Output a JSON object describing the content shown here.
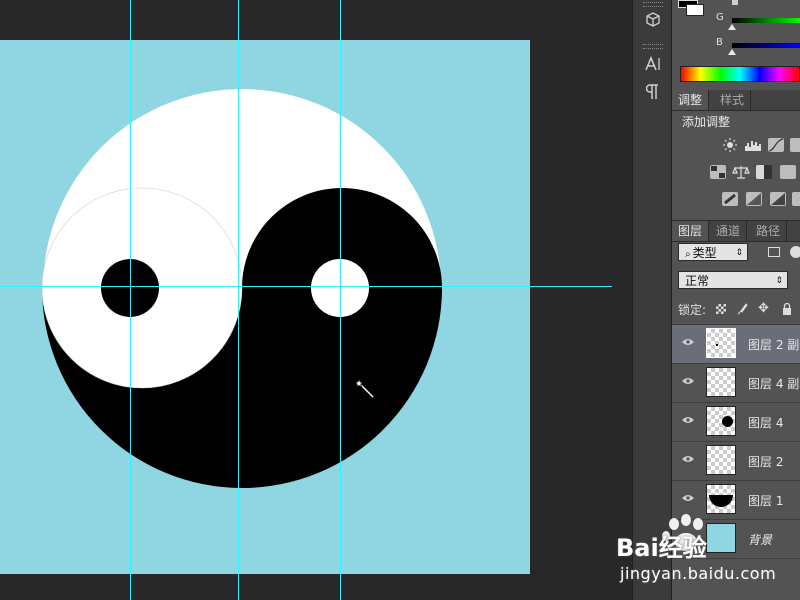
{
  "app": "Photoshop",
  "colors": {
    "canvas_bg": "#8fd5e2",
    "guide": "#2ff0ff",
    "panel_bg": "#535353",
    "selected_layer": "#6a6e78"
  },
  "color_panel": {
    "g_label": "G",
    "b_label": "B"
  },
  "adjustments": {
    "tabs": [
      {
        "label": "调整",
        "active": true
      },
      {
        "label": "样式",
        "active": false
      }
    ],
    "title": "添加调整",
    "icons": [
      "brightness-icon",
      "levels-icon",
      "curves-icon",
      "exposure-icon",
      "vibrance-icon",
      "hue-sat-icon",
      "color-balance-icon",
      "bw-icon",
      "photo-filter-icon",
      "invert-icon",
      "posterize-icon",
      "gradient-map-icon"
    ]
  },
  "layers_panel": {
    "tabs": [
      {
        "label": "图层",
        "active": true
      },
      {
        "label": "通道",
        "active": false
      },
      {
        "label": "路径",
        "active": false
      }
    ],
    "filter_label": "类型",
    "blend_mode": "正常",
    "lock_label": "锁定:",
    "layers": [
      {
        "name": "图层 2 副本",
        "selected": true,
        "thumb": "dot"
      },
      {
        "name": "图层 4 副本",
        "selected": false,
        "thumb": "empty"
      },
      {
        "name": "图层 4",
        "selected": false,
        "thumb": "black-dot"
      },
      {
        "name": "图层 2",
        "selected": false,
        "thumb": "empty"
      },
      {
        "name": "图层 1",
        "selected": false,
        "thumb": "half-circle"
      },
      {
        "name": "背景",
        "selected": false,
        "thumb": "blue-fill"
      }
    ]
  },
  "toolbar_icons": [
    "3d-icon",
    "character-icon",
    "paragraph-icon"
  ],
  "watermark": {
    "brand": "Bai经验",
    "url": "jingyan.baidu.com"
  }
}
